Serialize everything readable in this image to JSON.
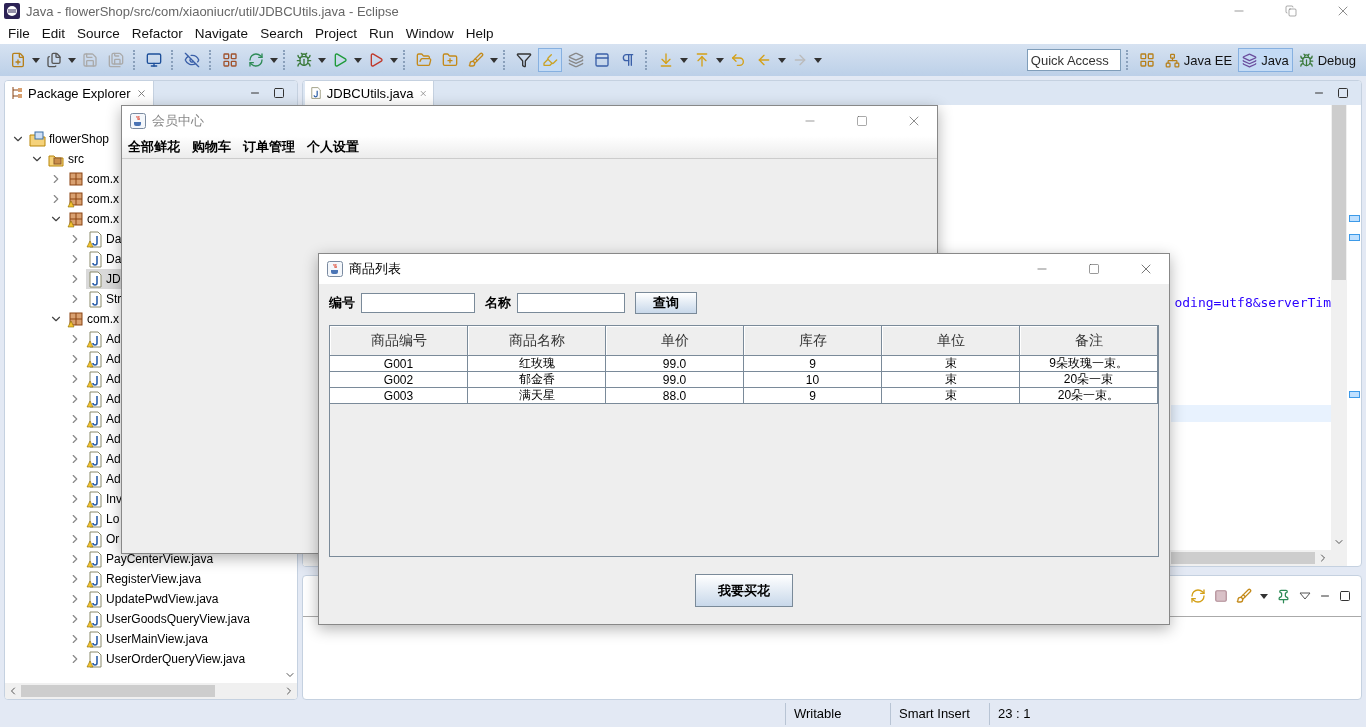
{
  "window": {
    "title": "Java - flowerShop/src/com/xiaoniucr/util/JDBCUtils.java - Eclipse"
  },
  "menu": [
    "File",
    "Edit",
    "Source",
    "Refactor",
    "Navigate",
    "Search",
    "Project",
    "Run",
    "Window",
    "Help"
  ],
  "quick_access": {
    "placeholder": "Quick Access"
  },
  "perspectives": [
    {
      "label": "Java EE",
      "selected": false
    },
    {
      "label": "Java",
      "selected": true
    },
    {
      "label": "Debug",
      "selected": false
    }
  ],
  "package_explorer": {
    "title": "Package Explorer",
    "tree": [
      {
        "label": "flowerShop",
        "kind": "project",
        "expanded": true,
        "selected": false,
        "warning": false,
        "children": [
          {
            "label": "src",
            "kind": "folder",
            "expanded": true,
            "selected": false,
            "warning": false,
            "children": [
              {
                "label": "com.x",
                "kind": "package",
                "expanded": false,
                "selected": false,
                "warning": false
              },
              {
                "label": "com.x",
                "kind": "package",
                "expanded": false,
                "selected": false,
                "warning": true
              },
              {
                "label": "com.x",
                "kind": "package",
                "expanded": true,
                "selected": false,
                "warning": true,
                "children": [
                  {
                    "label": "Da",
                    "kind": "java",
                    "expanded": false,
                    "selected": false,
                    "warning": true
                  },
                  {
                    "label": "Da",
                    "kind": "java",
                    "expanded": false,
                    "selected": false,
                    "warning": false
                  },
                  {
                    "label": "JD",
                    "kind": "java",
                    "expanded": false,
                    "selected": true,
                    "warning": false
                  },
                  {
                    "label": "Str",
                    "kind": "java",
                    "expanded": false,
                    "selected": false,
                    "warning": false
                  }
                ]
              },
              {
                "label": "com.x",
                "kind": "package",
                "expanded": true,
                "selected": false,
                "warning": true,
                "children": [
                  {
                    "label": "Ad",
                    "kind": "java",
                    "expanded": false,
                    "selected": false,
                    "warning": true
                  },
                  {
                    "label": "Ad",
                    "kind": "java",
                    "expanded": false,
                    "selected": false,
                    "warning": true
                  },
                  {
                    "label": "Ad",
                    "kind": "java",
                    "expanded": false,
                    "selected": false,
                    "warning": true
                  },
                  {
                    "label": "Ad",
                    "kind": "java",
                    "expanded": false,
                    "selected": false,
                    "warning": true
                  },
                  {
                    "label": "Ad",
                    "kind": "java",
                    "expanded": false,
                    "selected": false,
                    "warning": true
                  },
                  {
                    "label": "Ad",
                    "kind": "java",
                    "expanded": false,
                    "selected": false,
                    "warning": true
                  },
                  {
                    "label": "Ad",
                    "kind": "java",
                    "expanded": false,
                    "selected": false,
                    "warning": true
                  },
                  {
                    "label": "Ad",
                    "kind": "java",
                    "expanded": false,
                    "selected": false,
                    "warning": true
                  },
                  {
                    "label": "Inv",
                    "kind": "java",
                    "expanded": false,
                    "selected": false,
                    "warning": true
                  },
                  {
                    "label": "Lo",
                    "kind": "java",
                    "expanded": false,
                    "selected": false,
                    "warning": true
                  },
                  {
                    "label": "Or",
                    "kind": "java",
                    "expanded": false,
                    "selected": false,
                    "warning": true
                  },
                  {
                    "label": "PayCenterView.java",
                    "kind": "java",
                    "expanded": false,
                    "selected": false,
                    "warning": true
                  },
                  {
                    "label": "RegisterView.java",
                    "kind": "java",
                    "expanded": false,
                    "selected": false,
                    "warning": true
                  },
                  {
                    "label": "UpdatePwdView.java",
                    "kind": "java",
                    "expanded": false,
                    "selected": false,
                    "warning": true
                  },
                  {
                    "label": "UserGoodsQueryView.java",
                    "kind": "java",
                    "expanded": false,
                    "selected": false,
                    "warning": true
                  },
                  {
                    "label": "UserMainView.java",
                    "kind": "java",
                    "expanded": false,
                    "selected": false,
                    "warning": true
                  },
                  {
                    "label": "UserOrderQueryView.java",
                    "kind": "java",
                    "expanded": false,
                    "selected": false,
                    "warning": true
                  }
                ]
              }
            ]
          }
        ]
      }
    ]
  },
  "editor": {
    "tab": "JDBCUtils.java",
    "code_fragment": "oding=utf8&serverTim"
  },
  "member_window": {
    "title": "会员中心",
    "menu": [
      "全部鲜花",
      "购物车",
      "订单管理",
      "个人设置"
    ]
  },
  "goods_window": {
    "title": "商品列表",
    "filters": [
      {
        "label": "编号"
      },
      {
        "label": "名称"
      }
    ],
    "search_button": "查询",
    "table": {
      "columns": [
        "商品编号",
        "商品名称",
        "单价",
        "库存",
        "单位",
        "备注"
      ],
      "rows": [
        [
          "G001",
          "红玫瑰",
          "99.0",
          "9",
          "束",
          "9朵玫瑰一束。"
        ],
        [
          "G002",
          "郁金香",
          "99.0",
          "10",
          "束",
          "20朵一束"
        ],
        [
          "G003",
          "满天星",
          "88.0",
          "9",
          "束",
          "20朵一束。"
        ]
      ]
    },
    "buy_button": "我要买花"
  },
  "status_bar": [
    "Writable",
    "Smart Insert",
    "23 : 1"
  ]
}
